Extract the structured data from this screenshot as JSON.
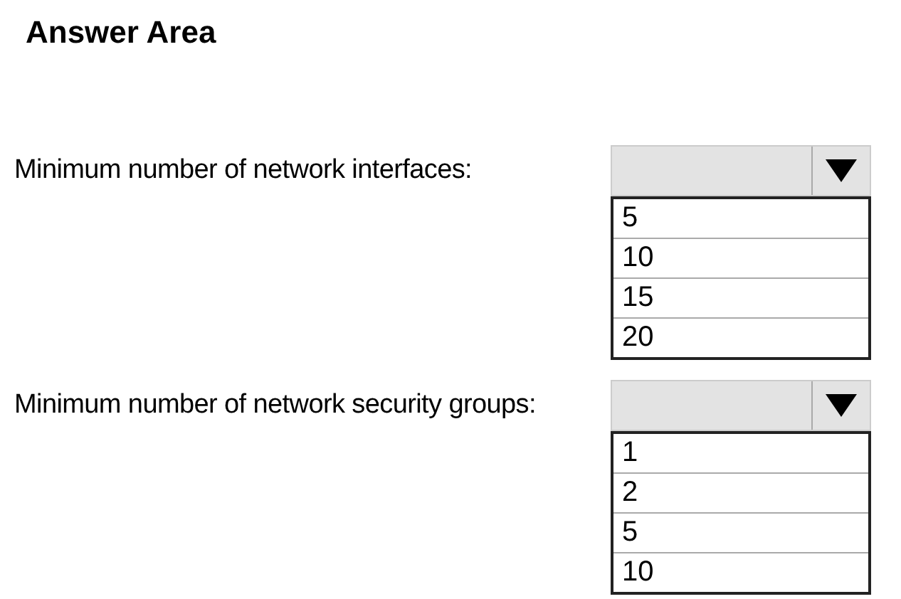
{
  "title": "Answer Area",
  "questions": [
    {
      "label": "Minimum number of network interfaces:",
      "options": [
        "5",
        "10",
        "15",
        "20"
      ]
    },
    {
      "label": "Minimum number of network security groups:",
      "options": [
        "1",
        "2",
        "5",
        "10"
      ]
    }
  ]
}
